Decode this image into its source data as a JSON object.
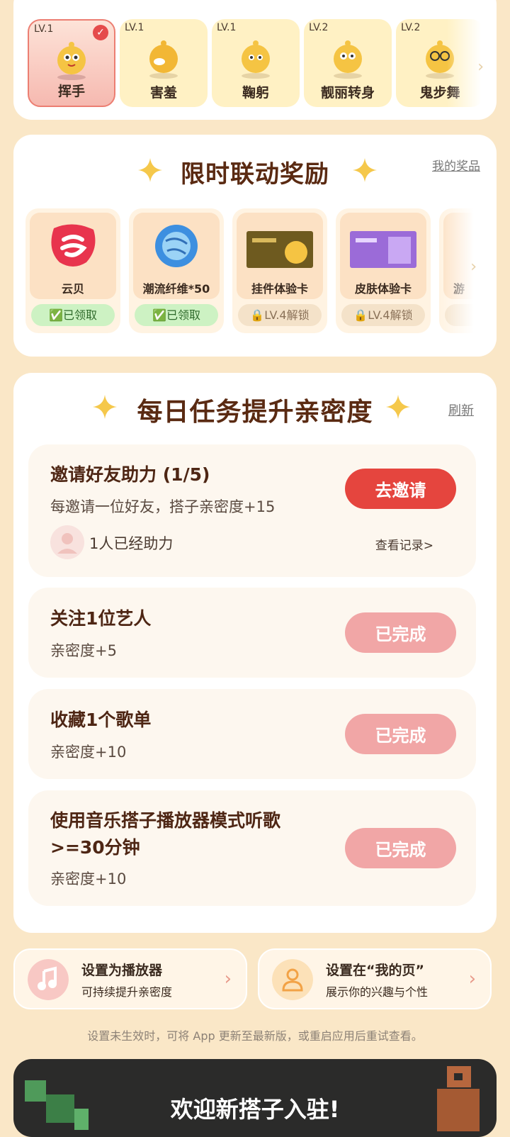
{
  "actions": [
    {
      "level": "LV.1",
      "name": "挥手",
      "selected": true
    },
    {
      "level": "LV.1",
      "name": "害羞",
      "selected": false
    },
    {
      "level": "LV.1",
      "name": "鞠躬",
      "selected": false
    },
    {
      "level": "LV.2",
      "name": "靓丽转身",
      "selected": false
    },
    {
      "level": "LV.2",
      "name": "鬼步舞",
      "selected": false
    }
  ],
  "rewards": {
    "title": "限时联动奖励",
    "link": "我的奖品",
    "items": [
      {
        "name": "云贝",
        "status": "已领取",
        "state": "claimed"
      },
      {
        "name": "潮流纤维*50",
        "status": "已领取",
        "state": "claimed"
      },
      {
        "name": "挂件体验卡",
        "status": "LV.4解锁",
        "state": "locked"
      },
      {
        "name": "皮肤体验卡",
        "status": "LV.4解锁",
        "state": "locked"
      },
      {
        "name": "游",
        "status": "",
        "state": "locked"
      }
    ]
  },
  "tasks": {
    "title": "每日任务提升亲密度",
    "refresh": "刷新",
    "items": [
      {
        "title": "邀请好友助力 (1/5)",
        "sub": "每邀请一位好友，搭子亲密度+15",
        "button": "去邀请",
        "helped": "1人已经助力",
        "record": "查看记录>"
      },
      {
        "title": "关注1位艺人",
        "sub": "亲密度+5",
        "button": "已完成"
      },
      {
        "title": "收藏1个歌单",
        "sub": "亲密度+10",
        "button": "已完成"
      },
      {
        "title_line1": "使用音乐搭子播放器模式听歌",
        "title_line2": ">=30分钟",
        "sub": "亲密度+10",
        "button": "已完成"
      }
    ]
  },
  "settings": [
    {
      "title": "设置为播放器",
      "sub": "可持续提升亲密度"
    },
    {
      "title": "设置在“我的页”",
      "sub": "展示你的兴趣与个性"
    }
  ],
  "note": "设置未生效时，可将 App 更新至最新版，或重启应用后重试查看。",
  "banner": {
    "title": "欢迎新搭子入驻!"
  },
  "colors": {
    "accent_red": "#E5453E",
    "done_pink": "#F1A6A6",
    "page_bg": "#FAE7C7",
    "title_brown": "#5a2a12"
  }
}
